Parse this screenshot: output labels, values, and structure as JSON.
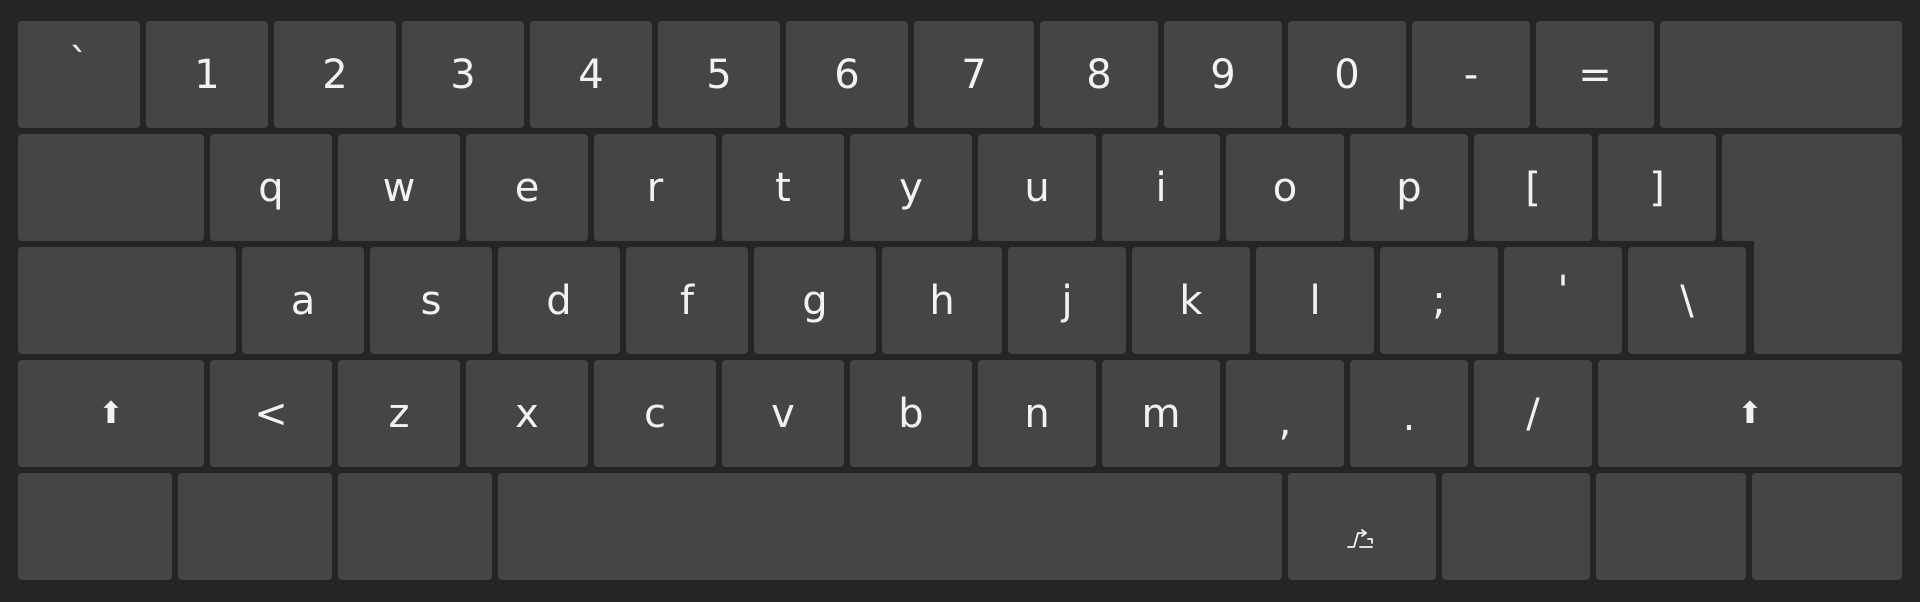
{
  "keyboard": {
    "row1": [
      "`",
      "1",
      "2",
      "3",
      "4",
      "5",
      "6",
      "7",
      "8",
      "9",
      "0",
      "-",
      "="
    ],
    "row2": [
      "q",
      "w",
      "e",
      "r",
      "t",
      "y",
      "u",
      "i",
      "o",
      "p",
      "[",
      "]"
    ],
    "row3": [
      "a",
      "s",
      "d",
      "f",
      "g",
      "h",
      "j",
      "k",
      "l",
      ";",
      "'",
      "\\"
    ],
    "row4": [
      "<",
      "z",
      "x",
      "c",
      "v",
      "b",
      "n",
      "m",
      ",",
      ".",
      "/"
    ],
    "shift_symbol": "⬆",
    "alt_gr_icon": "alt-gr-icon",
    "colors": {
      "background": "#252525",
      "key": "#454545",
      "text": "#f2f2f2"
    }
  }
}
